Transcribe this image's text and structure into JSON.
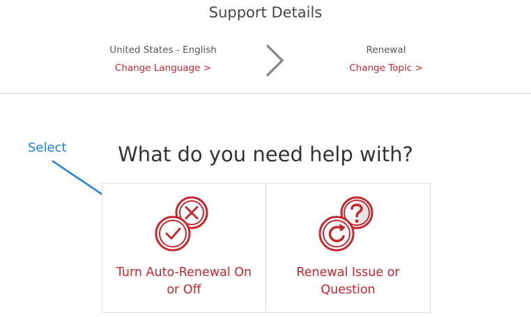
{
  "header": {
    "title": "Support Details"
  },
  "breadcrumb": {
    "language": {
      "label": "United States - English",
      "link": "Change Language >"
    },
    "topic": {
      "label": "Renewal",
      "link": "Change Topic >"
    }
  },
  "annotation": {
    "text": "Select"
  },
  "main": {
    "question": "What do you need help with?",
    "options": [
      {
        "label": "Turn Auto-Renewal On or Off",
        "icon": "check-x-icon"
      },
      {
        "label": "Renewal Issue or Question",
        "icon": "refresh-question-icon"
      }
    ]
  },
  "colors": {
    "brand_red": "#c8262c",
    "annotation_blue": "#1a7de0",
    "text_gray": "#555555"
  }
}
